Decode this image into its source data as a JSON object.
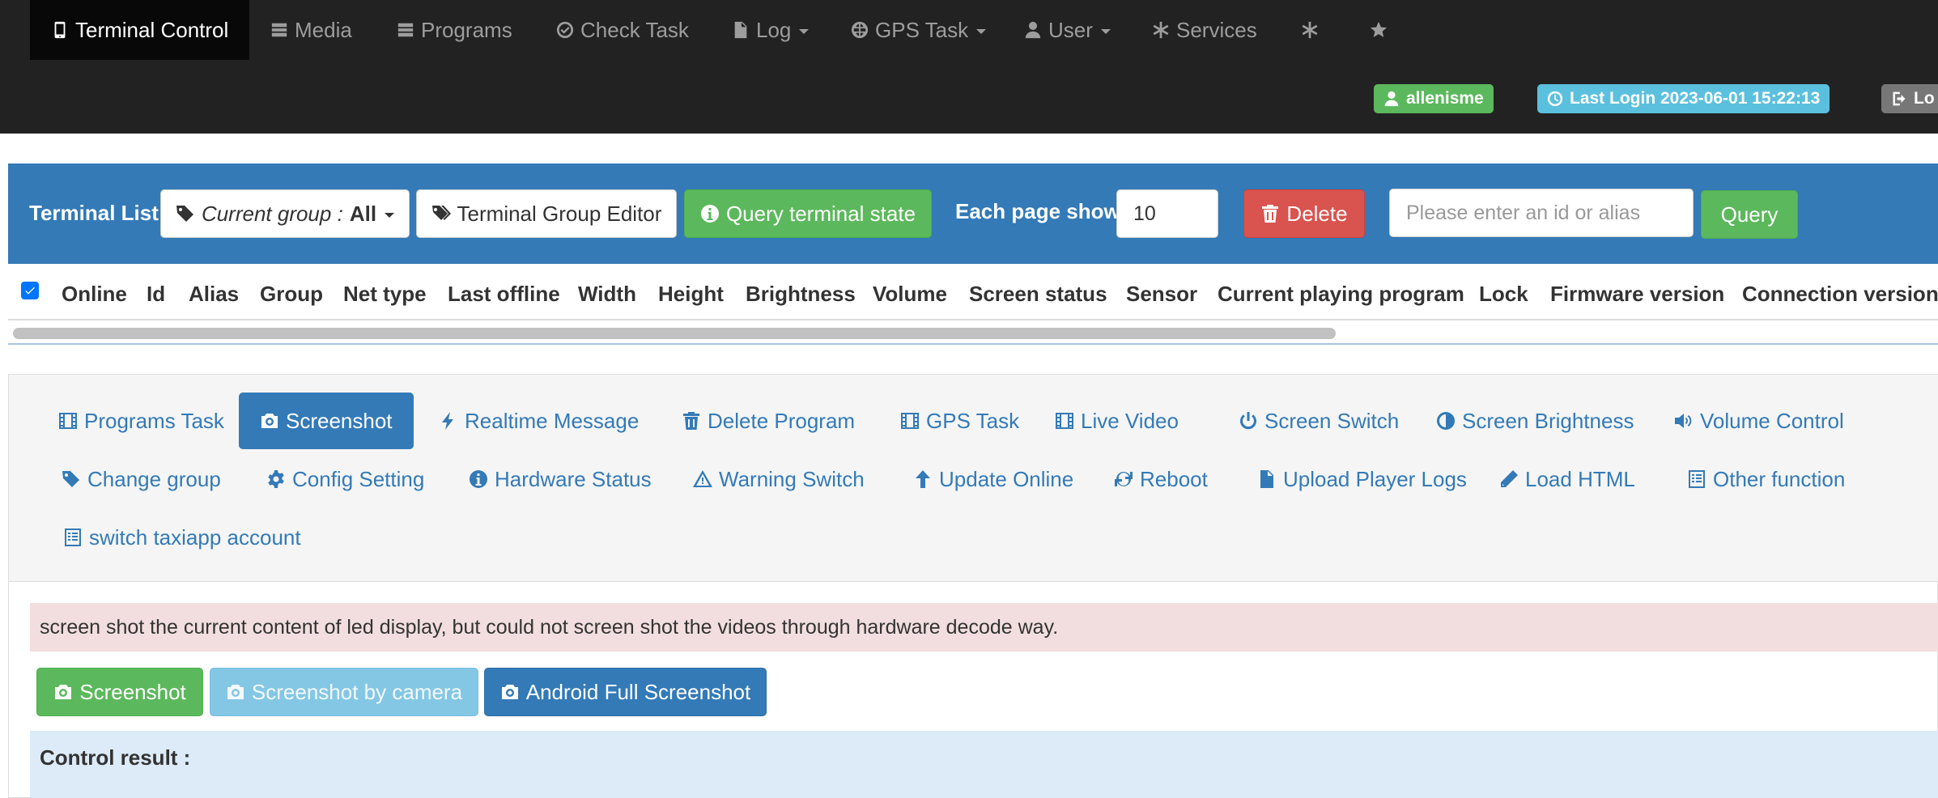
{
  "navbar": {
    "items": [
      {
        "label": "Terminal Control",
        "icon": "mobile-icon",
        "active": true
      },
      {
        "label": "Media",
        "icon": "list-icon"
      },
      {
        "label": "Programs",
        "icon": "list-icon"
      },
      {
        "label": "Check Task",
        "icon": "check-circle-icon"
      },
      {
        "label": "Log",
        "icon": "file-icon",
        "dropdown": true
      },
      {
        "label": "GPS Task",
        "icon": "globe-icon",
        "dropdown": true
      },
      {
        "label": "User",
        "icon": "user-icon",
        "dropdown": true
      },
      {
        "label": "Services",
        "icon": "asterisk-icon"
      },
      {
        "label": "",
        "icon": "asterisk-icon"
      },
      {
        "label": "",
        "icon": "star-icon"
      }
    ],
    "username": "allenisme",
    "last_login": "Last Login 2023-06-01 15:22:13",
    "logout": "Lo"
  },
  "terminal_list": {
    "title": "Terminal List",
    "group_prefix": "Current group :",
    "group_value": "All",
    "group_editor": "Terminal Group Editor",
    "query_state": "Query terminal state",
    "each_page_label": "Each page show",
    "page_size": "10",
    "delete": "Delete",
    "search_placeholder": "Please enter an id or alias",
    "query": "Query",
    "columns": [
      "Online",
      "Id",
      "Alias",
      "Group",
      "Net type",
      "Last offline",
      "Width",
      "Height",
      "Brightness",
      "Volume",
      "Screen status",
      "Sensor",
      "Current playing program",
      "Lock",
      "Firmware version",
      "Connection version"
    ]
  },
  "actions": {
    "tabs": [
      {
        "label": "Programs Task",
        "icon": "film-icon"
      },
      {
        "label": "Screenshot",
        "icon": "camera-icon",
        "active": true
      },
      {
        "label": "Realtime Message",
        "icon": "flash-icon"
      },
      {
        "label": "Delete Program",
        "icon": "trash-icon"
      },
      {
        "label": "GPS Task",
        "icon": "film-icon"
      },
      {
        "label": "Live Video",
        "icon": "film-icon"
      },
      {
        "label": "Screen Switch",
        "icon": "power-icon"
      },
      {
        "label": "Screen Brightness",
        "icon": "adjust-icon"
      },
      {
        "label": "Volume Control",
        "icon": "volume-icon"
      },
      {
        "label": "Change group",
        "icon": "tag-icon"
      },
      {
        "label": "Config Setting",
        "icon": "cog-icon"
      },
      {
        "label": "Hardware Status",
        "icon": "info-icon"
      },
      {
        "label": "Warning Switch",
        "icon": "warning-icon"
      },
      {
        "label": "Update Online",
        "icon": "arrow-up-icon"
      },
      {
        "label": "Reboot",
        "icon": "refresh-icon"
      },
      {
        "label": "Upload Player Logs",
        "icon": "file-icon"
      },
      {
        "label": "Load HTML",
        "icon": "pencil-icon"
      },
      {
        "label": "Other function",
        "icon": "list-alt-icon"
      },
      {
        "label": "switch taxiapp account",
        "icon": "list-alt-icon"
      }
    ],
    "description": "screen shot the current content of led display, but could not screen shot the videos through hardware decode way.",
    "buttons": {
      "screenshot": "Screenshot",
      "by_camera": "Screenshot by camera",
      "android_full": "Android Full Screenshot"
    },
    "control_result": "Control result :"
  }
}
